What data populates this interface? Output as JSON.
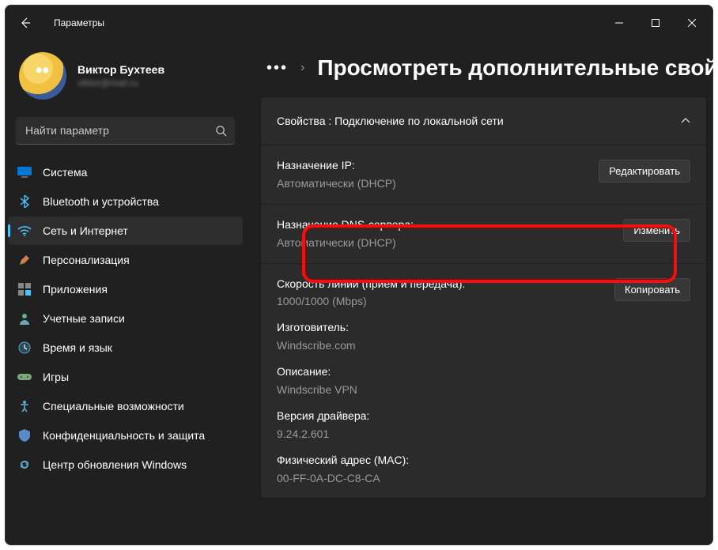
{
  "window": {
    "title": "Параметры"
  },
  "user": {
    "name": "Виктор Бухтеев",
    "email": "viktor@mail.ru"
  },
  "search": {
    "placeholder": "Найти параметр"
  },
  "nav": {
    "items": [
      {
        "label": "Система"
      },
      {
        "label": "Bluetooth и устройства"
      },
      {
        "label": "Сеть и Интернет"
      },
      {
        "label": "Персонализация"
      },
      {
        "label": "Приложения"
      },
      {
        "label": "Учетные записи"
      },
      {
        "label": "Время и язык"
      },
      {
        "label": "Игры"
      },
      {
        "label": "Специальные возможности"
      },
      {
        "label": "Конфиденциальность и защита"
      },
      {
        "label": "Центр обновления Windows"
      }
    ]
  },
  "page": {
    "title": "Просмотреть дополнительные свой"
  },
  "panel": {
    "title": "Свойства : Подключение по локальной сети",
    "rows": {
      "ip": {
        "label": "Назначение IP:",
        "value": "Автоматически (DHCP)",
        "button": "Редактировать"
      },
      "dns": {
        "label": "Назначение DNS-сервера:",
        "value": "Автоматически (DHCP)",
        "button": "Изменить"
      },
      "copy_btn": "Копировать",
      "speed": {
        "label": "Скорость линии (прием и передача):",
        "value": "1000/1000 (Mbps)"
      },
      "vendor": {
        "label": "Изготовитель:",
        "value": "Windscribe.com"
      },
      "desc": {
        "label": "Описание:",
        "value": "Windscribe VPN"
      },
      "driver": {
        "label": "Версия драйвера:",
        "value": "9.24.2.601"
      },
      "mac": {
        "label": "Физический адрес (MAC):",
        "value": "00-FF-0A-DC-C8-CA"
      }
    }
  }
}
